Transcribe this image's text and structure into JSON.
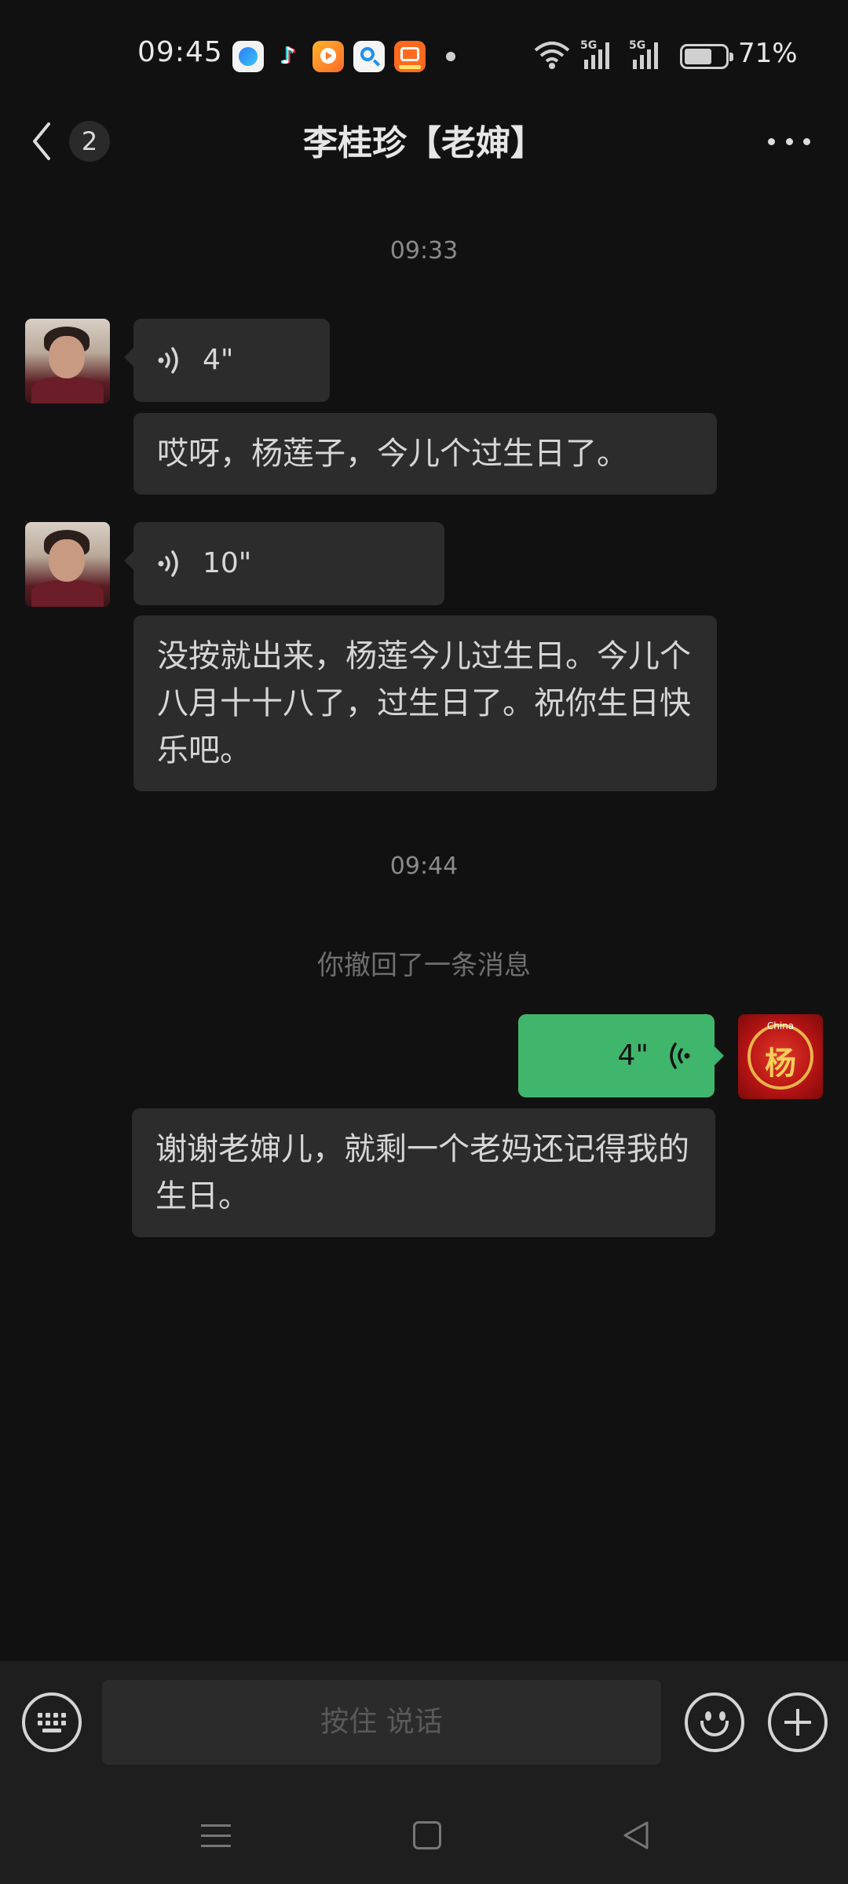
{
  "status_bar": {
    "time": "09:45",
    "app_icons": [
      "browser-app-icon",
      "douyin-app-icon",
      "video-app-icon",
      "search-app-icon",
      "shop-app-icon"
    ],
    "network": "5G",
    "battery": "71%",
    "battery_level": 0.71
  },
  "header": {
    "back_badge": "2",
    "title": "李桂珍【老婶】"
  },
  "chat": {
    "timestamps": [
      "09:33",
      "09:44"
    ],
    "messages": [
      {
        "from": "friend",
        "type": "voice",
        "duration": "4\""
      },
      {
        "from": "friend",
        "type": "text",
        "text": "哎呀，杨莲子，今儿个过生日了。"
      },
      {
        "from": "friend",
        "type": "voice",
        "duration": "10\""
      },
      {
        "from": "friend",
        "type": "text",
        "text": "没按就出来，杨莲今儿过生日。今儿个八月十十八了，过生日了。祝你生日快乐吧。"
      },
      {
        "from": "system",
        "type": "notice",
        "text": "你撤回了一条消息"
      },
      {
        "from": "me",
        "type": "voice",
        "duration": "4\""
      },
      {
        "from": "me",
        "type": "transcript",
        "text": "谢谢老婶儿，就剩一个老妈还记得我的生日。"
      }
    ],
    "my_avatar": {
      "top_text": "China",
      "char": "杨"
    }
  },
  "input_bar": {
    "hold_to_talk": "按住 说话"
  },
  "colors": {
    "background": "#111111",
    "bubble_received": "#2c2c2c",
    "bubble_sent": "#3fb66b"
  }
}
